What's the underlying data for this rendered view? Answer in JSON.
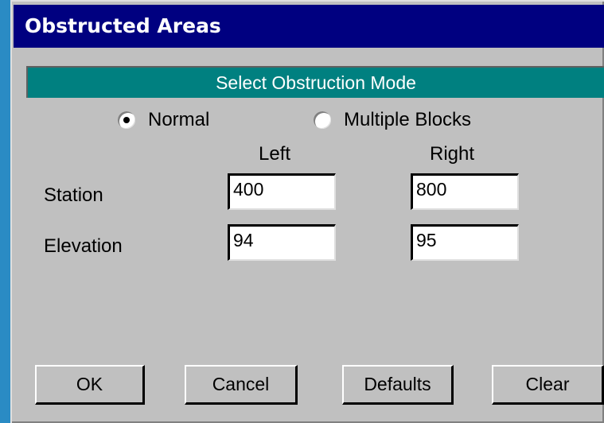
{
  "window": {
    "title": "Obstructed Areas"
  },
  "mode_header": "Select Obstruction Mode",
  "modes": {
    "normal_label": "Normal",
    "multiple_label": "Multiple Blocks",
    "selected": "Normal"
  },
  "columns": {
    "left": "Left",
    "right": "Right"
  },
  "rows": {
    "station": {
      "label": "Station",
      "left": "400",
      "right": "800"
    },
    "elevation": {
      "label": "Elevation",
      "left": "94",
      "right": "95"
    }
  },
  "buttons": {
    "ok": "OK",
    "cancel": "Cancel",
    "defaults": "Defaults",
    "clear": "Clear"
  }
}
